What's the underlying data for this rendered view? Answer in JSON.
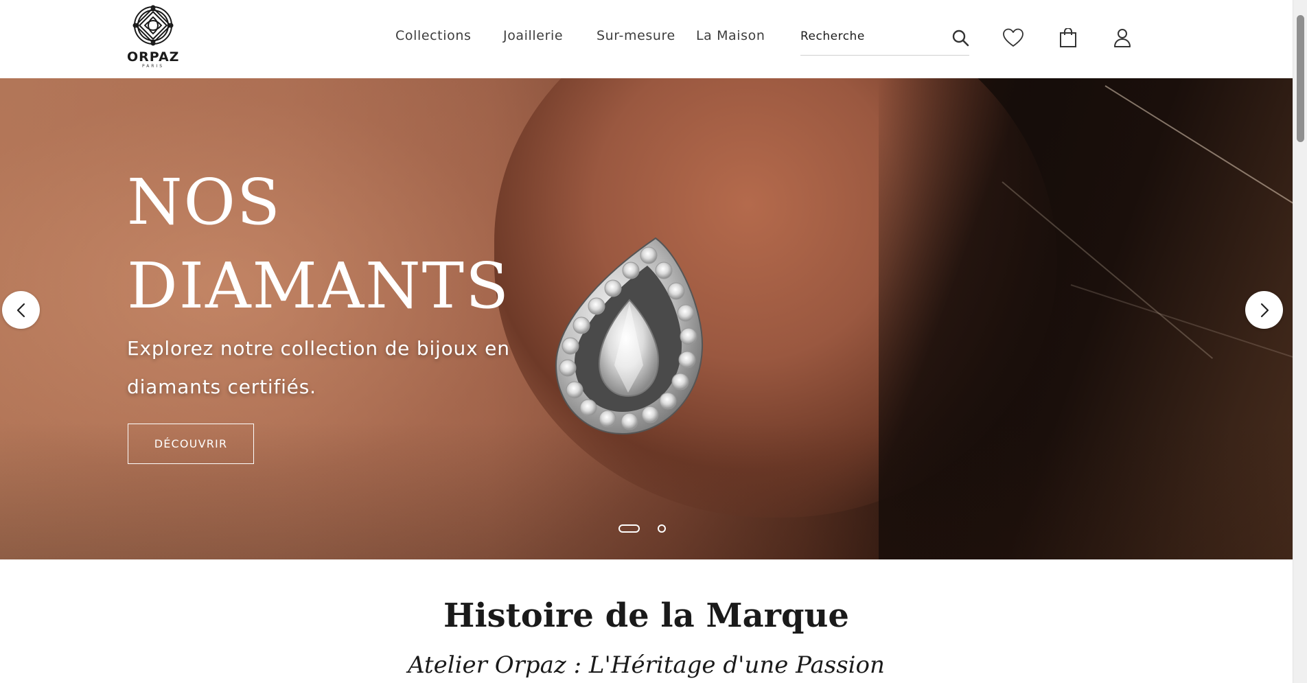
{
  "header": {
    "logo": {
      "wordmark": "ORPAZ",
      "subtitle": "PARIS"
    },
    "nav": [
      {
        "label": "Collections"
      },
      {
        "label": "Joaillerie"
      },
      {
        "label": "Sur-mesure"
      },
      {
        "label": "La Maison"
      }
    ],
    "search": {
      "placeholder": "Recherche",
      "value": ""
    },
    "icons": [
      "search-icon",
      "heart-icon",
      "shopping-bag-icon",
      "user-icon"
    ]
  },
  "hero": {
    "title_line1": "NOS",
    "title_line2": "DIAMANTS",
    "subtitle_line1": "Explorez notre collection de bijoux en",
    "subtitle_line2": "diamants certifiés.",
    "cta_label": "DÉCOUVRIR",
    "slides_total": 2,
    "active_slide": 1
  },
  "section": {
    "title": "Histoire de la Marque",
    "subtitle": "Atelier Orpaz : L'Héritage d'une Passion"
  },
  "colors": {
    "text": "#2b2b2b",
    "hero_text": "#ffffff",
    "background": "#ffffff"
  }
}
